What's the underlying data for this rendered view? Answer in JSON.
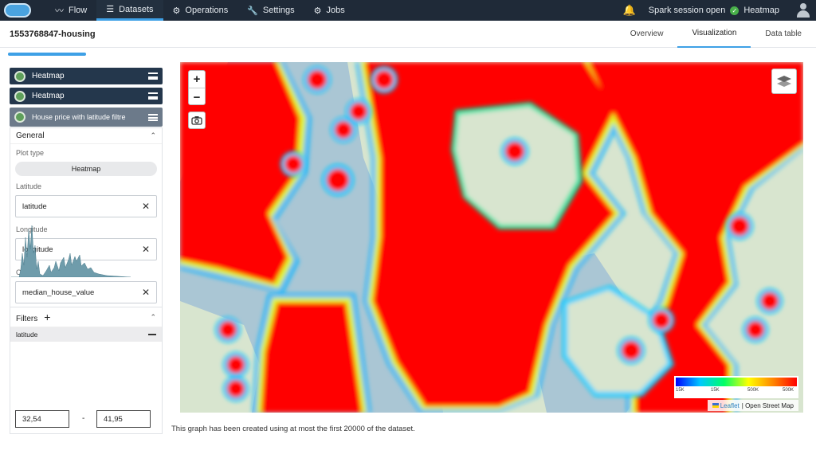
{
  "nav": {
    "items": [
      {
        "icon": "flow-icon",
        "glyph": "〰",
        "label": "Flow"
      },
      {
        "icon": "datasets-icon",
        "glyph": "☰",
        "label": "Datasets"
      },
      {
        "icon": "operations-icon",
        "glyph": "⚙",
        "label": "Operations"
      },
      {
        "icon": "settings-icon",
        "glyph": "🔧",
        "label": "Settings"
      },
      {
        "icon": "jobs-icon",
        "glyph": "⚙",
        "label": "Jobs"
      }
    ],
    "session_status": "Spark session open",
    "current_view": "Heatmap"
  },
  "header": {
    "dataset_title": "1553768847-housing",
    "tabs": [
      "Overview",
      "Visualization",
      "Data table"
    ],
    "active_tab": "Visualization"
  },
  "layers": [
    {
      "label": "Heatmap"
    },
    {
      "label": "Heatmap"
    },
    {
      "label": "House price with latitude filtre"
    }
  ],
  "general": {
    "title": "General",
    "plot_type_label": "Plot type",
    "plot_type_value": "Heatmap",
    "latitude_label": "Latitude",
    "latitude_value": "latitude",
    "longitude_label": "Longitude",
    "longitude_value": "longitude",
    "count_label": "Count",
    "count_value": "median_house_value"
  },
  "filters": {
    "title": "Filters",
    "filter_name": "latitude",
    "range_min": "32,54",
    "range_sep": "-",
    "range_max": "41,95"
  },
  "map": {
    "legend_ticks": [
      "15K",
      "15K",
      "500K",
      "500K"
    ],
    "attribution_leaflet": "Leaflet",
    "attribution_osm": "| Open Street Map"
  },
  "note": "This graph has been created using at most the first 20000 of the dataset.",
  "colors": {
    "accent": "#3ea0e6",
    "nav_bg": "#1f2a38",
    "heat": "#ff0000"
  }
}
